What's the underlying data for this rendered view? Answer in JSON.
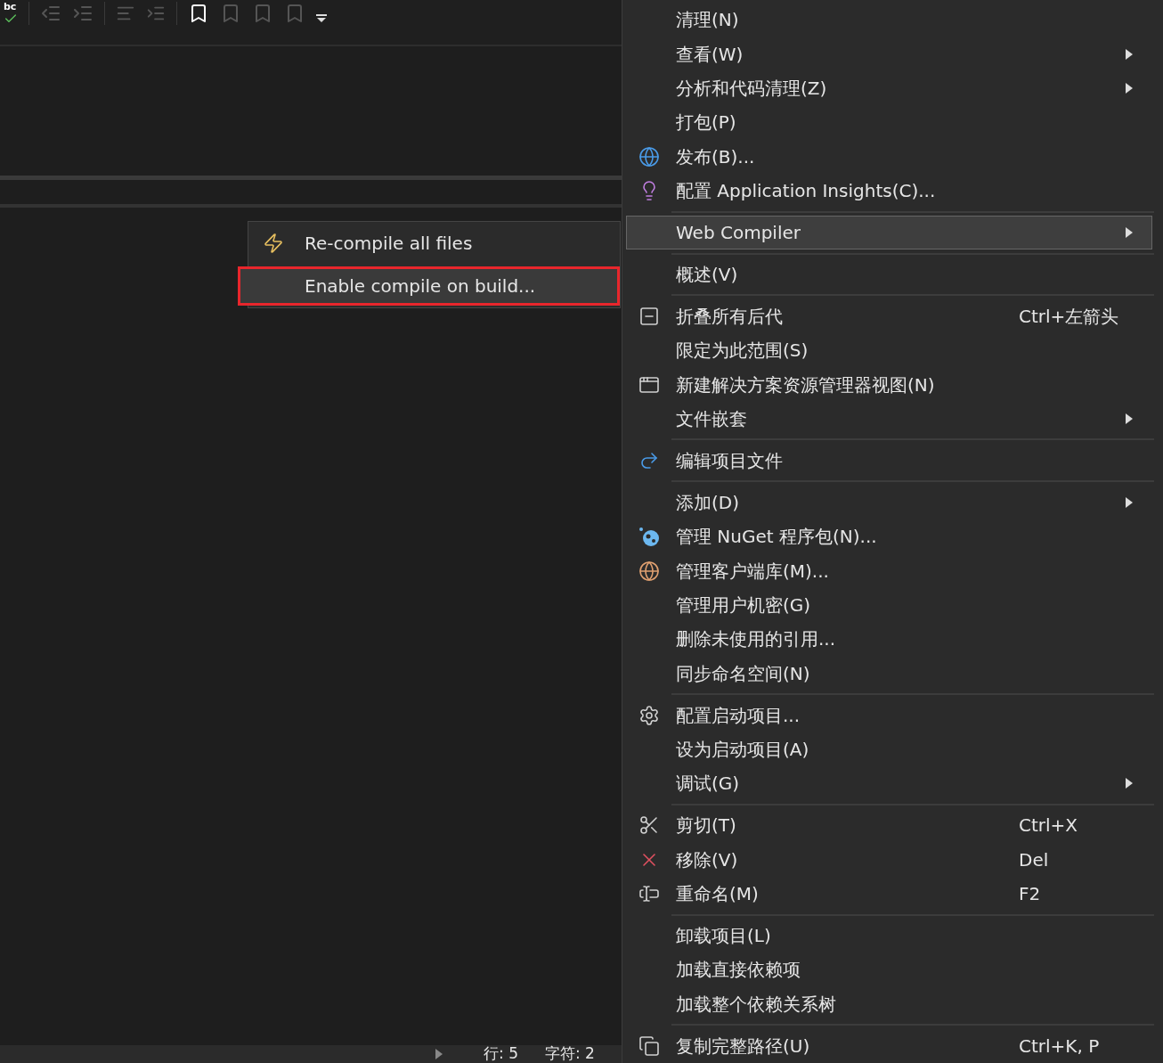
{
  "toolbar": {
    "spellcheck_label": "bc"
  },
  "status_bar": {
    "line": "行: 5",
    "column": "字符: 2"
  },
  "submenu": [
    {
      "label": "Re-compile all files",
      "selected": false,
      "annotated": false
    },
    {
      "label": "Enable compile on build...",
      "selected": true,
      "annotated": true
    }
  ],
  "context_menu": [
    {
      "kind": "item",
      "label": "清理(N)",
      "submenu": false,
      "selected": false
    },
    {
      "kind": "item",
      "label": "查看(W)",
      "submenu": true,
      "selected": false
    },
    {
      "kind": "item",
      "label": "分析和代码清理(Z)",
      "submenu": true,
      "selected": false
    },
    {
      "kind": "item",
      "label": "打包(P)",
      "submenu": false,
      "selected": false
    },
    {
      "kind": "item",
      "label": "发布(B)...",
      "submenu": false,
      "selected": false
    },
    {
      "kind": "item",
      "label": "配置 Application Insights(C)...",
      "submenu": false,
      "selected": false
    },
    {
      "kind": "separator"
    },
    {
      "kind": "item",
      "label": "Web Compiler",
      "submenu": true,
      "selected": true
    },
    {
      "kind": "separator"
    },
    {
      "kind": "item",
      "label": "概述(V)",
      "submenu": false,
      "selected": false
    },
    {
      "kind": "separator"
    },
    {
      "kind": "item",
      "label": "折叠所有后代",
      "shortcut": "Ctrl+左箭头",
      "submenu": false,
      "selected": false
    },
    {
      "kind": "item",
      "label": "限定为此范围(S)",
      "submenu": false,
      "selected": false
    },
    {
      "kind": "item",
      "label": "新建解决方案资源管理器视图(N)",
      "submenu": false,
      "selected": false
    },
    {
      "kind": "item",
      "label": "文件嵌套",
      "submenu": true,
      "selected": false
    },
    {
      "kind": "separator"
    },
    {
      "kind": "item",
      "label": "编辑项目文件",
      "submenu": false,
      "selected": false
    },
    {
      "kind": "separator"
    },
    {
      "kind": "item",
      "label": "添加(D)",
      "submenu": true,
      "selected": false
    },
    {
      "kind": "item",
      "label": "管理 NuGet 程序包(N)...",
      "submenu": false,
      "selected": false
    },
    {
      "kind": "item",
      "label": "管理客户端库(M)...",
      "submenu": false,
      "selected": false
    },
    {
      "kind": "item",
      "label": "管理用户机密(G)",
      "submenu": false,
      "selected": false
    },
    {
      "kind": "item",
      "label": "删除未使用的引用...",
      "submenu": false,
      "selected": false
    },
    {
      "kind": "item",
      "label": "同步命名空间(N)",
      "submenu": false,
      "selected": false
    },
    {
      "kind": "separator"
    },
    {
      "kind": "item",
      "label": "配置启动项目...",
      "submenu": false,
      "selected": false
    },
    {
      "kind": "item",
      "label": "设为启动项目(A)",
      "submenu": false,
      "selected": false
    },
    {
      "kind": "item",
      "label": "调试(G)",
      "submenu": true,
      "selected": false
    },
    {
      "kind": "separator"
    },
    {
      "kind": "item",
      "label": "剪切(T)",
      "shortcut": "Ctrl+X",
      "submenu": false,
      "selected": false
    },
    {
      "kind": "item",
      "label": "移除(V)",
      "shortcut": "Del",
      "submenu": false,
      "selected": false
    },
    {
      "kind": "item",
      "label": "重命名(M)",
      "shortcut": "F2",
      "submenu": false,
      "selected": false
    },
    {
      "kind": "separator"
    },
    {
      "kind": "item",
      "label": "卸载项目(L)",
      "submenu": false,
      "selected": false
    },
    {
      "kind": "item",
      "label": "加载直接依赖项",
      "submenu": false,
      "selected": false
    },
    {
      "kind": "item",
      "label": "加载整个依赖关系树",
      "submenu": false,
      "selected": false
    },
    {
      "kind": "separator"
    },
    {
      "kind": "item",
      "label": "复制完整路径(U)",
      "shortcut": "Ctrl+K, P",
      "submenu": false,
      "selected": false
    }
  ]
}
